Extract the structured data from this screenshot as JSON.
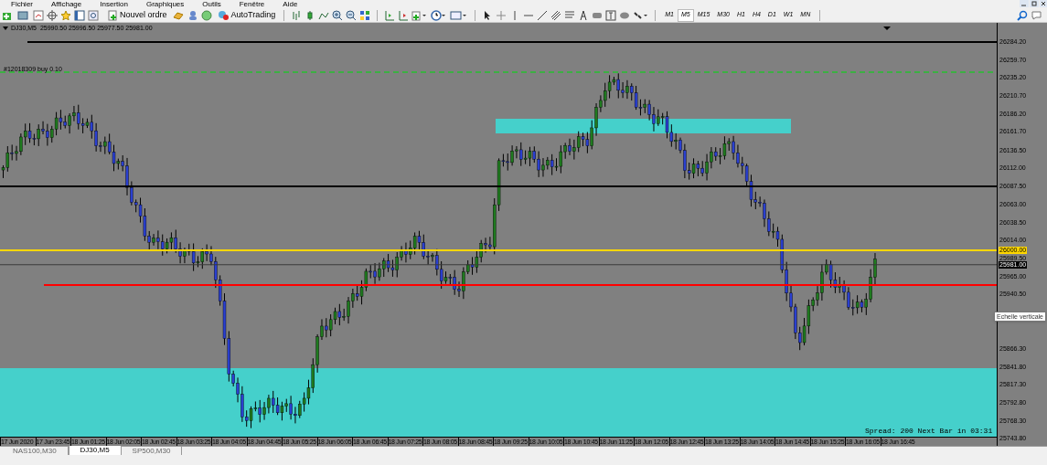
{
  "menu": [
    "Fichier",
    "Affichage",
    "Insertion",
    "Graphiques",
    "Outils",
    "Fenêtre",
    "Aide"
  ],
  "toolbar": {
    "new_order": "Nouvel ordre",
    "autotrading": "AutoTrading"
  },
  "timeframes": [
    {
      "label": "M1",
      "selected": false
    },
    {
      "label": "M5",
      "selected": true
    },
    {
      "label": "M15",
      "selected": false
    },
    {
      "label": "M30",
      "selected": false
    },
    {
      "label": "H1",
      "selected": false
    },
    {
      "label": "H4",
      "selected": false
    },
    {
      "label": "D1",
      "selected": false
    },
    {
      "label": "W1",
      "selected": false
    },
    {
      "label": "MN",
      "selected": false
    }
  ],
  "chart": {
    "symbol_line": "DJ30,M5  25990.50 25996.50 25977.50 25981.00",
    "trade_label": "#12018309 buy 0.10",
    "spread_text": "Spread: 200 Next Bar in 03:31",
    "tooltip": "Echelle verticale",
    "horizontal_lines": [
      {
        "color": "#000000",
        "kind": "solid"
      },
      {
        "color": "#3cb043",
        "kind": "dashed"
      },
      {
        "color": "#000000",
        "kind": "solid"
      },
      {
        "color": "#ffd700",
        "kind": "solid"
      },
      {
        "color": "#ff0000",
        "kind": "solid"
      }
    ],
    "price_axis": [
      {
        "text": "26284.20",
        "kind": "tick"
      },
      {
        "text": "26259.70",
        "kind": "tick"
      },
      {
        "text": "26235.20",
        "kind": "tick"
      },
      {
        "text": "26210.70",
        "kind": "tick"
      },
      {
        "text": "26186.20",
        "kind": "tick"
      },
      {
        "text": "26161.70",
        "kind": "tick"
      },
      {
        "text": "26136.50",
        "kind": "tick"
      },
      {
        "text": "26112.00",
        "kind": "tick"
      },
      {
        "text": "26087.50",
        "kind": "tick"
      },
      {
        "text": "26063.00",
        "kind": "tick"
      },
      {
        "text": "26038.50",
        "kind": "tick"
      },
      {
        "text": "26014.00",
        "kind": "tick"
      },
      {
        "text": "26000.00",
        "kind": "line"
      },
      {
        "text": "25989.50",
        "kind": "tick"
      },
      {
        "text": "25981.00",
        "kind": "bid"
      },
      {
        "text": "25965.00",
        "kind": "tick"
      },
      {
        "text": "25940.50",
        "kind": "tick"
      },
      {
        "text": "25866.30",
        "kind": "tick"
      },
      {
        "text": "25841.80",
        "kind": "tick"
      },
      {
        "text": "25817.30",
        "kind": "tick"
      },
      {
        "text": "25792.80",
        "kind": "tick"
      },
      {
        "text": "25768.30",
        "kind": "tick"
      },
      {
        "text": "25743.80",
        "kind": "tick"
      }
    ],
    "time_axis": [
      "17 Jun 2020",
      "17 Jun 23:45",
      "18 Jun 01:25",
      "18 Jun 02:05",
      "18 Jun 02:45",
      "18 Jun 03:25",
      "18 Jun 04:05",
      "18 Jun 04:45",
      "18 Jun 05:25",
      "18 Jun 06:05",
      "18 Jun 06:45",
      "18 Jun 07:25",
      "18 Jun 08:05",
      "18 Jun 08:45",
      "18 Jun 09:25",
      "18 Jun 10:05",
      "18 Jun 10:45",
      "18 Jun 11:25",
      "18 Jun 12:05",
      "18 Jun 12:45",
      "18 Jun 13:25",
      "18 Jun 14:05",
      "18 Jun 14:45",
      "18 Jun 15:25",
      "18 Jun 16:05",
      "18 Jun 16:45"
    ]
  },
  "tabs": [
    {
      "label": "NAS100,M30",
      "selected": false
    },
    {
      "label": "DJ30,M5",
      "selected": true
    },
    {
      "label": "SP500,M30",
      "selected": false
    }
  ]
}
